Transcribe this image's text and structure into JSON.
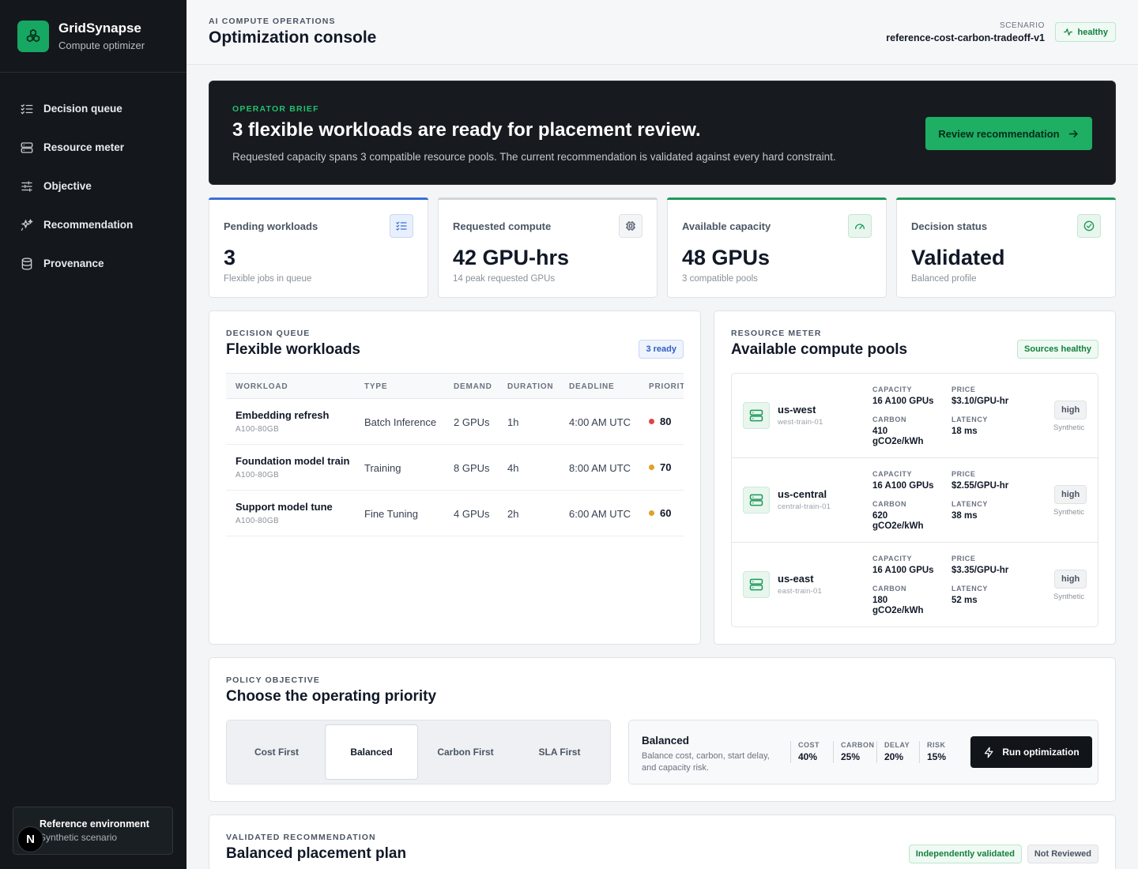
{
  "app": {
    "name": "GridSynapse",
    "subtitle": "Compute optimizer"
  },
  "sidebar": {
    "items": [
      {
        "label": "Decision queue",
        "icon": "list-check-icon"
      },
      {
        "label": "Resource meter",
        "icon": "server-icon"
      },
      {
        "label": "Objective",
        "icon": "sliders-icon"
      },
      {
        "label": "Recommendation",
        "icon": "sparkles-icon"
      },
      {
        "label": "Provenance",
        "icon": "database-icon"
      }
    ],
    "environment": {
      "title": "Reference environment",
      "subtitle": "Synthetic scenario",
      "avatar": "N"
    }
  },
  "header": {
    "eyebrow": "AI COMPUTE OPERATIONS",
    "title": "Optimization console",
    "scenario_label": "SCENARIO",
    "scenario_value": "reference-cost-carbon-tradeoff-v1",
    "status": "healthy"
  },
  "brief": {
    "eyebrow": "OPERATOR BRIEF",
    "title": "3 flexible workloads are ready for placement review.",
    "text": "Requested capacity spans 3 compatible resource pools. The current recommendation is validated against every hard constraint.",
    "button": "Review recommendation"
  },
  "kpis": [
    {
      "label": "Pending workloads",
      "value": "3",
      "sub": "Flexible jobs in queue",
      "accent": "#3b6fd8",
      "icon": "list-check-icon"
    },
    {
      "label": "Requested compute",
      "value": "42 GPU-hrs",
      "sub": "14 peak requested GPUs",
      "accent": "#d1d5db",
      "icon": "chip-icon"
    },
    {
      "label": "Available capacity",
      "value": "48 GPUs",
      "sub": "3 compatible pools",
      "accent": "#1e9a5a",
      "icon": "gauge-icon"
    },
    {
      "label": "Decision status",
      "value": "Validated",
      "sub": "Balanced profile",
      "accent": "#1e9a5a",
      "icon": "check-circle-icon"
    }
  ],
  "queue": {
    "eyebrow": "DECISION QUEUE",
    "title": "Flexible workloads",
    "badge": "3 ready",
    "columns": [
      "WORKLOAD",
      "TYPE",
      "DEMAND",
      "DURATION",
      "DEADLINE",
      "PRIORITY"
    ],
    "rows": [
      {
        "name": "Embedding refresh",
        "sku": "A100-80GB",
        "type": "Batch Inference",
        "demand": "2 GPUs",
        "duration": "1h",
        "deadline": "4:00 AM UTC",
        "priority": "80",
        "priority_color": "#e04545"
      },
      {
        "name": "Foundation model train",
        "sku": "A100-80GB",
        "type": "Training",
        "demand": "8 GPUs",
        "duration": "4h",
        "deadline": "8:00 AM UTC",
        "priority": "70",
        "priority_color": "#e0a12a"
      },
      {
        "name": "Support model tune",
        "sku": "A100-80GB",
        "type": "Fine Tuning",
        "demand": "4 GPUs",
        "duration": "2h",
        "deadline": "6:00 AM UTC",
        "priority": "60",
        "priority_color": "#e0a12a"
      }
    ]
  },
  "pools": {
    "eyebrow": "RESOURCE METER",
    "title": "Available compute pools",
    "badge": "Sources healthy",
    "labels": {
      "capacity": "CAPACITY",
      "price": "PRICE",
      "carbon": "CARBON",
      "latency": "LATENCY"
    },
    "items": [
      {
        "name": "us-west",
        "id": "west-train-01",
        "capacity": "16 A100 GPUs",
        "price": "$3.10/GPU-hr",
        "carbon_value": "410",
        "carbon_unit": "gCO2e/kWh",
        "latency": "18 ms",
        "tier": "high",
        "source": "Synthetic"
      },
      {
        "name": "us-central",
        "id": "central-train-01",
        "capacity": "16 A100 GPUs",
        "price": "$2.55/GPU-hr",
        "carbon_value": "620",
        "carbon_unit": "gCO2e/kWh",
        "latency": "38 ms",
        "tier": "high",
        "source": "Synthetic"
      },
      {
        "name": "us-east",
        "id": "east-train-01",
        "capacity": "16 A100 GPUs",
        "price": "$3.35/GPU-hr",
        "carbon_value": "180",
        "carbon_unit": "gCO2e/kWh",
        "latency": "52 ms",
        "tier": "high",
        "source": "Synthetic"
      }
    ]
  },
  "policy": {
    "eyebrow": "POLICY OBJECTIVE",
    "title": "Choose the operating priority",
    "options": [
      "Cost First",
      "Balanced",
      "Carbon First",
      "SLA First"
    ],
    "selected": "Balanced",
    "profile_title": "Balanced",
    "profile_desc": "Balance cost, carbon, start delay, and capacity risk.",
    "weights": [
      {
        "label": "COST",
        "value": "40%"
      },
      {
        "label": "CARBON",
        "value": "25%"
      },
      {
        "label": "DELAY",
        "value": "20%"
      },
      {
        "label": "RISK",
        "value": "15%"
      }
    ],
    "run_button": "Run optimization"
  },
  "recommendation": {
    "eyebrow": "VALIDATED RECOMMENDATION",
    "title": "Balanced placement plan",
    "badge_validated": "Independently validated",
    "badge_review": "Not Reviewed"
  }
}
